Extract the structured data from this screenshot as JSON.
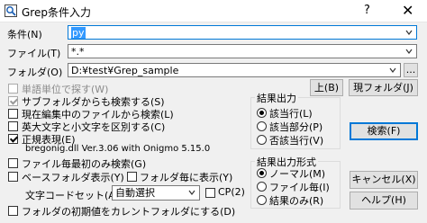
{
  "window": {
    "title": "Grep条件入力",
    "help": "?",
    "close": "✕"
  },
  "condition": {
    "label": "条件(N)",
    "value": "py"
  },
  "file": {
    "label": "ファイル(T)",
    "value": "*.*"
  },
  "folder": {
    "label": "フォルダ(O)",
    "value": "D:¥test¥Grep_sample",
    "browse": "..."
  },
  "buttons": {
    "up": "上(B)",
    "current_folder": "現フォルダ(J)",
    "search": "検索(F)",
    "cancel": "キャンセル(X)",
    "help": "ヘルプ(H)"
  },
  "options": {
    "word_unit": "単語単位で探す(W)",
    "subfolders": "サブフォルダからも検索する(S)",
    "current_file": "現在編集中のファイルから検索(L)",
    "case_sensitive": "英大文字と小文字を区別する(C)",
    "regex": "正規表現(E)",
    "regex_info": "bregonig.dll Ver.3.06 with Onigmo 5.15.0",
    "first_match": "ファイル毎最初のみ検索(G)",
    "base_folder": "ベースフォルダ表示(Y)",
    "per_folder": "フォルダ毎に表示(Y)",
    "charset_label": "文字コードセット(A)",
    "charset_value": "自動選択",
    "cp": "CP(2)",
    "set_default_folder": "フォルダの初期値をカレントフォルダにする(D)"
  },
  "result_output": {
    "title": "結果出力",
    "items": [
      "該当行(L)",
      "該当部分(P)",
      "否該当行(V)"
    ]
  },
  "result_format": {
    "title": "結果出力形式",
    "items": [
      "ノーマル(M)",
      "ファイル毎(I)",
      "結果のみ(R)"
    ]
  }
}
